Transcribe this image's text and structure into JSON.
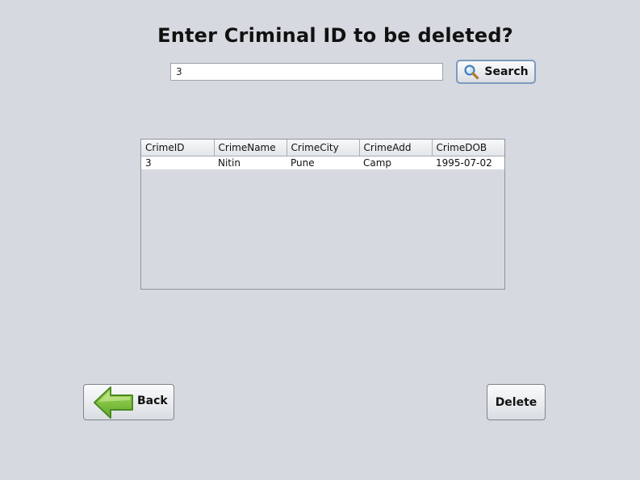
{
  "title": "Enter Criminal ID to be deleted?",
  "search": {
    "value": "3",
    "button_label": "Search",
    "icon": "magnifier-icon"
  },
  "table": {
    "columns": [
      "CrimeID",
      "CrimeName",
      "CrimeCity",
      "CrimeAdd",
      "CrimeDOB"
    ],
    "rows": [
      [
        "3",
        "Nitin",
        "Pune",
        "Camp",
        "1995-07-02"
      ]
    ]
  },
  "buttons": {
    "back_label": "Back",
    "back_icon": "green-left-arrow-icon",
    "delete_label": "Delete"
  },
  "colors": {
    "background": "#d6d9df",
    "arrow_green": "#7cc242",
    "search_focus_border": "#7b9bc0"
  }
}
